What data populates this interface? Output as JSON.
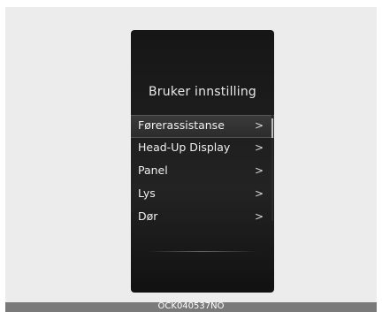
{
  "screen": {
    "title": "Bruker innstilling",
    "menu_items": [
      {
        "label": "Førerassistanse",
        "chevron": ">",
        "selected": true
      },
      {
        "label": "Head-Up Display",
        "chevron": ">",
        "selected": false
      },
      {
        "label": "Panel",
        "chevron": ">",
        "selected": false
      },
      {
        "label": "Lys",
        "chevron": ">",
        "selected": false
      },
      {
        "label": "Dør",
        "chevron": ">",
        "selected": false
      }
    ]
  },
  "caption": {
    "code": "OCK040537NO"
  },
  "colors": {
    "screen_background": "#1c1c1c",
    "text": "#f0f0f0",
    "caption_bar": "#7a7a7a",
    "backdrop": "#ececec"
  }
}
